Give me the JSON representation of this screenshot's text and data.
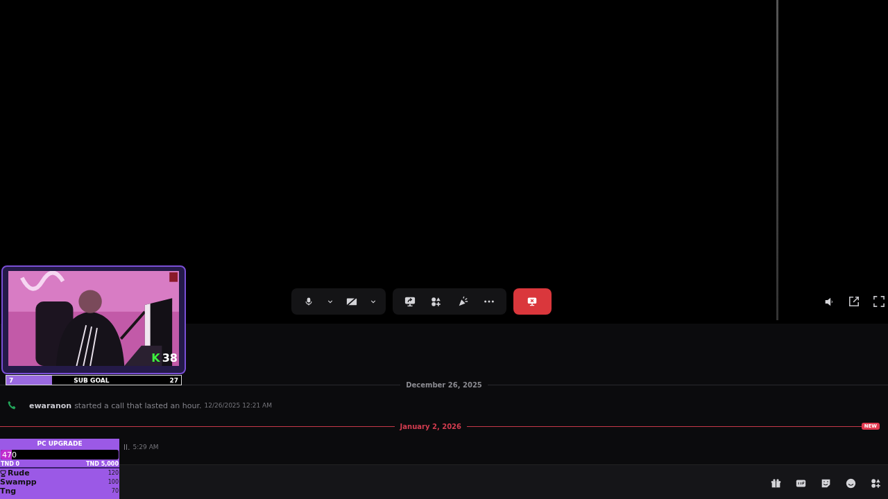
{
  "webcam_overlay": {
    "kill_letter": "K",
    "kill_count": "38",
    "sub_goal": {
      "label": "SUB GOAL",
      "current": "7",
      "target": "27",
      "level": 0.26
    }
  },
  "messages": [
    {
      "kind": "date_divider",
      "date": "December 26, 2025",
      "new": false
    },
    {
      "kind": "call",
      "author": "ewaranon",
      "text": "started a call that lasted an hour.",
      "time": "12/26/2025 12:21 AM"
    },
    {
      "kind": "date_divider",
      "date": "January 2, 2026",
      "new": true,
      "badge": "NEW"
    },
    {
      "kind": "call_partial",
      "text": "ll.",
      "time": "5:29 AM"
    }
  ],
  "donation_widget": {
    "title": "PC UPGRADE",
    "amount": "470",
    "level": 0.094,
    "min": "TND 0",
    "max": "TND 5,000",
    "leaders": [
      {
        "name": "Rude",
        "amount": "120",
        "top": true
      },
      {
        "name": "Swampp",
        "amount": "100",
        "top": false
      },
      {
        "name": "Tng",
        "amount": "70",
        "top": false
      }
    ]
  }
}
